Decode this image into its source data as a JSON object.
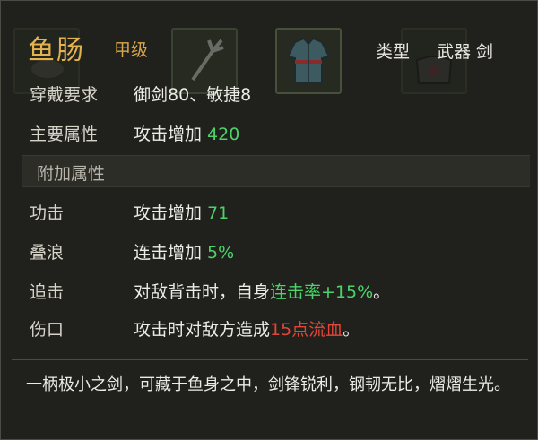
{
  "item": {
    "name": "鱼肠",
    "grade": "甲级",
    "type_label": "类型",
    "type_value": "武器 剑"
  },
  "requirements": {
    "label": "穿戴要求",
    "value": "御剑80、敏捷8"
  },
  "main_attr": {
    "label": "主要属性",
    "text": "攻击增加 ",
    "number": "420"
  },
  "extra_section": {
    "title": "附加属性"
  },
  "extra_attrs": [
    {
      "label": "功击",
      "text": "攻击增加 ",
      "number": "71"
    },
    {
      "label": "叠浪",
      "text": "连击增加 ",
      "number": "5%"
    }
  ],
  "special": [
    {
      "label": "追击",
      "pre": "对敌背击时，自身",
      "highlight": "连击率+15%",
      "post": "。"
    },
    {
      "label": "伤口",
      "pre": "攻击时对敌方造成",
      "highlight": "15点流血",
      "post": "。"
    }
  ],
  "description": "一柄极小之剑，可藏于鱼身之中，剑锋锐利，钢韧无比，熠熠生光。",
  "slot_icons": [
    "fist-icon",
    "trident-icon",
    "robe-icon",
    "armor-icon"
  ],
  "colors": {
    "name": "#e4b24e",
    "green": "#4bd36a",
    "red": "#e2463a"
  }
}
